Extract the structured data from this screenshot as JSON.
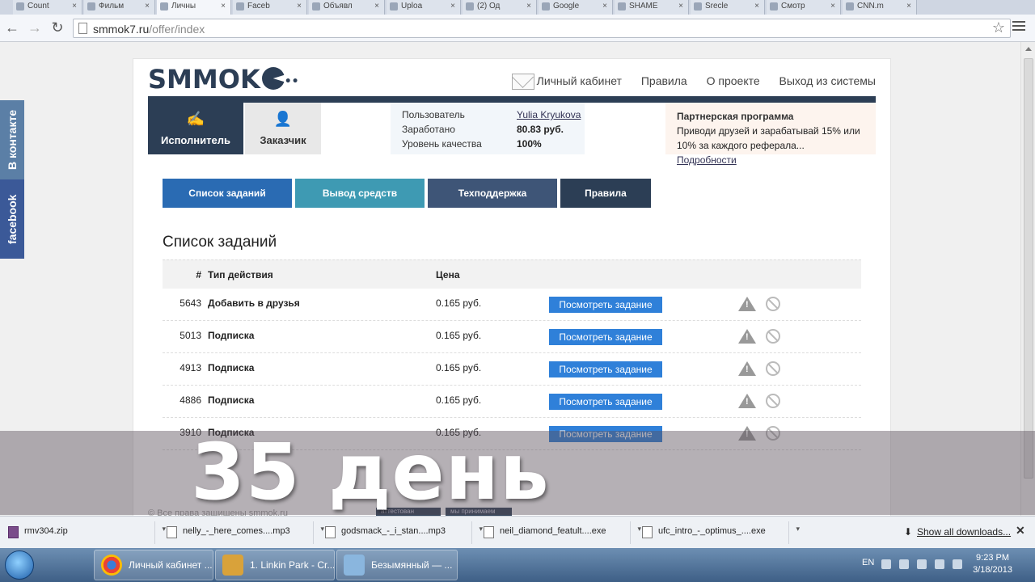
{
  "browser": {
    "tabs": [
      {
        "label": "Count"
      },
      {
        "label": "Фильм"
      },
      {
        "label": "Личны"
      },
      {
        "label": "Faceb"
      },
      {
        "label": "Объявл"
      },
      {
        "label": "Uploa"
      },
      {
        "label": "(2) Од"
      },
      {
        "label": "Google"
      },
      {
        "label": "SHAME"
      },
      {
        "label": "Srecle"
      },
      {
        "label": "Смотр"
      },
      {
        "label": "CNN.m"
      }
    ],
    "url_domain": "smmok7.ru",
    "url_path": "/offer/index"
  },
  "social": {
    "vk_label": "В контакте",
    "fb_label": "facebook"
  },
  "site": {
    "logo_text": "SMMOK",
    "nav": [
      "Личный кабинет",
      "Правила",
      "О проекте",
      "Выход из системы"
    ],
    "roles": {
      "executor": "Исполнитель",
      "customer": "Заказчик"
    },
    "stats": {
      "user_label": "Пользователь",
      "user_value": "Yulia Kryukova",
      "earned_label": "Заработано",
      "earned_value": "80.83 руб.",
      "quality_label": "Уровень качества",
      "quality_value": "100%"
    },
    "partner": {
      "title": "Партнерская программа",
      "text": "Приводи друзей и зарабатывай 15% или 10% за каждого реферала...",
      "link": "Подробности"
    },
    "tabs": [
      {
        "label": "Список заданий",
        "color": "#2a6bb3"
      },
      {
        "label": "Вывод средств",
        "color": "#3e9ab3"
      },
      {
        "label": "Техподдержка",
        "color": "#3e5577"
      },
      {
        "label": "Правила",
        "color": "#2c3e55"
      }
    ],
    "section_title": "Список заданий",
    "table": {
      "headers": {
        "num": "#",
        "type": "Тип действия",
        "price": "Цена"
      },
      "button_label": "Посмотреть задание",
      "rows": [
        {
          "num": "5643",
          "type": "Добавить в друзья",
          "price": "0.165 руб."
        },
        {
          "num": "5013",
          "type": "Подписка",
          "price": "0.165 руб."
        },
        {
          "num": "4913",
          "type": "Подписка",
          "price": "0.165 руб."
        },
        {
          "num": "4886",
          "type": "Подписка",
          "price": "0.165 руб."
        },
        {
          "num": "3910",
          "type": "Подписка",
          "price": "0.165 руб."
        }
      ]
    },
    "footer": {
      "copyright": "© Все права защищены smmok.ru",
      "badge1": "аттестован",
      "badge2": "мы принимаем"
    }
  },
  "overlay_caption": "35 день",
  "downloads": {
    "items": [
      {
        "name": "rmv304.zip",
        "type": "rar"
      },
      {
        "name": "nelly_-_here_comes....mp3",
        "type": "file"
      },
      {
        "name": "godsmack_-_i_stan....mp3",
        "type": "file"
      },
      {
        "name": "neil_diamond_featult....exe",
        "type": "file"
      },
      {
        "name": "ufc_intro_-_optimus_....exe",
        "type": "file"
      }
    ],
    "show_all": "Show all downloads..."
  },
  "taskbar": {
    "items": [
      {
        "label": "Личный кабинет ..."
      },
      {
        "label": "1. Linkin Park - Cr..."
      },
      {
        "label": "Безымянный — ..."
      }
    ],
    "lang": "EN",
    "time": "9:23 PM",
    "date": "3/18/2013"
  }
}
